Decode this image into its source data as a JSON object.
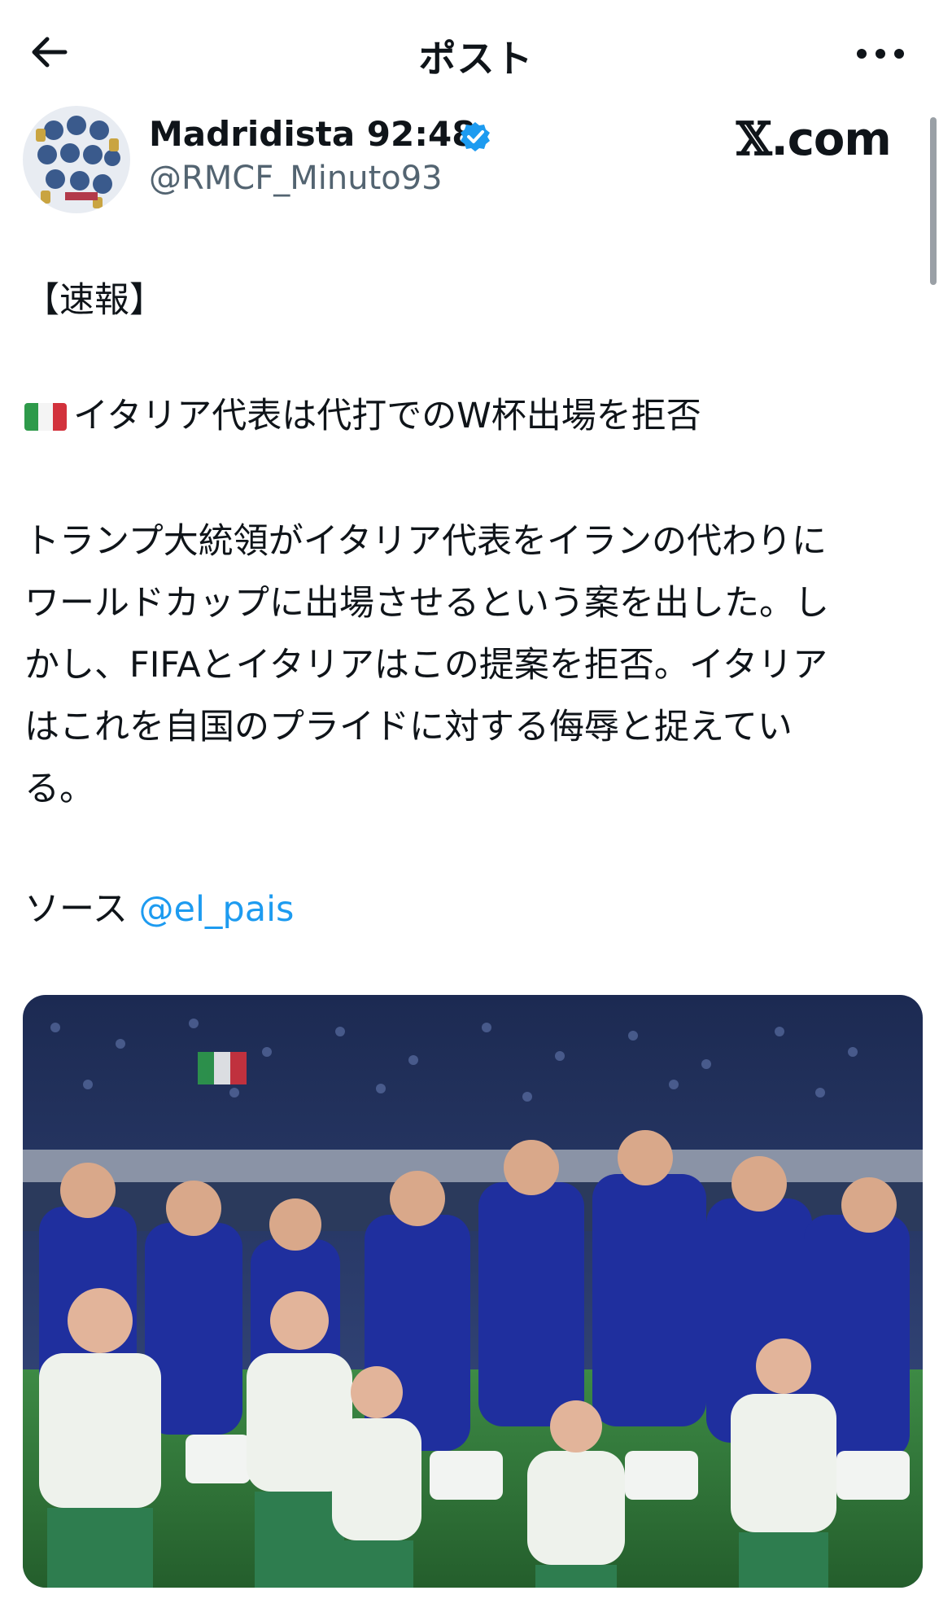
{
  "header": {
    "title": "ポスト",
    "back_icon": "arrow-left-icon",
    "more_icon": "more-horizontal-icon"
  },
  "author": {
    "display_name": "Madridista 92:48",
    "handle": "@RMCF_Minuto93",
    "verified": true,
    "verified_color": "#1d9bf0"
  },
  "brand": {
    "x": "𝕏",
    "rest": ".com"
  },
  "post": {
    "tag": "【速報】",
    "headline": "イタリア代表は代打でのW杯出場を拒否",
    "headline_flag": "italy-flag-icon",
    "body_lines": [
      "トランプ大統領がイタリア代表をイランの代わりに",
      "ワールドカップに出場させるという案を出した。し",
      "かし、FIFAとイタリアはこの提案を拒否。イタリア",
      "はこれを自国のプライドに対する侮辱と捉えてい",
      "る。"
    ],
    "source_label": "ソース ",
    "source_mention": "@el_pais",
    "mention_color": "#1d9bf0"
  },
  "media": {
    "type": "photo",
    "colors": {
      "pitch": "#2f7a3a",
      "jersey": "#1f2f9e",
      "kid_shirt": "#eef2ec",
      "kid_shorts": "#2e7d4f",
      "crowd": "#263a6e"
    }
  }
}
